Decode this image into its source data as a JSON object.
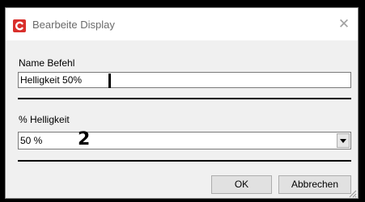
{
  "window": {
    "title": "Bearbeite Display",
    "close_glyph": "✕",
    "app_icon": "app-logo-icon",
    "colors": {
      "accent": "#d9302c",
      "window_bg": "#f0f0f0",
      "outer_bg": "#000000"
    }
  },
  "form": {
    "name_label": "Name Befehl",
    "name_value": "Helligkeit 50%",
    "brightness_label": "% Helligkeit",
    "brightness_selected": "50 %",
    "annotation_marker": "2"
  },
  "buttons": {
    "ok_label": "OK",
    "cancel_label": "Abbrechen"
  }
}
